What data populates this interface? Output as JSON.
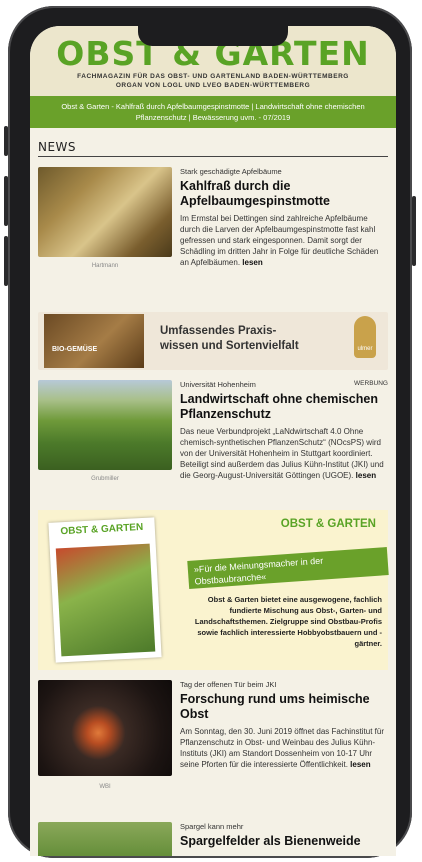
{
  "masthead": {
    "logo": "OBST & GARTEN",
    "tagline_1": "FACHMAGAZIN FÜR DAS OBST- UND GARTENLAND BADEN-WÜRTTEMBERG",
    "tagline_2": "ORGAN VON LOGL UND LVEO BADEN-WÜRTTEMBERG"
  },
  "topic_banner": "Obst & Garten - Kahlfraß durch Apfelbaumgespinstmotte | Landwirtschaft ohne chemischen Pflanzenschutz | Bewässerung uvm. - 07/2019",
  "news_heading": "NEWS",
  "articles": [
    {
      "kicker": "Stark geschädigte Apfelbäume",
      "headline": "Kahlfraß durch die Apfelbaumgespinstmotte",
      "body": "Im Ermstal bei Dettingen sind zahlreiche Apfelbäume durch die Larven der Apfelbaumgespinstmotte fast kahl gefressen und stark eingesponnen. Damit sorgt der Schädling im dritten Jahr in Folge für deutliche Schäden an Apfelbäumen.",
      "more": "lesen",
      "credit": "Hartmann"
    },
    {
      "kicker": "Universität Hohenheim",
      "label": "WERBUNG",
      "headline": "Landwirtschaft ohne chemischen Pflanzenschutz",
      "body": "Das neue Verbundprojekt „LaNdwirtschaft 4.0 Ohne chemisch-synthetischen PflanzenSchutz“ (NOcsPS) wird von der Universität Hohenheim in Stuttgart koordiniert. Beteiligt sind außerdem das Julius Kühn-Institut (JKI) und die Georg-August-Universität Göttingen (UGOE).",
      "more": "lesen",
      "credit": "Grubmiller"
    },
    {
      "kicker": "Tag der offenen Tür beim JKI",
      "headline": "Forschung rund ums heimische Obst",
      "body": "Am Sonntag, den 30. Juni 2019 öffnet das Fachinstitut für Pflanzenschutz in Obst- und Weinbau des Julius Kühn-Instituts (JKI) am Standort Dossenheim von 10-17 Uhr seine Pforten für die interessierte Öffentlichkeit.",
      "more": "lesen",
      "credit": "WBI"
    },
    {
      "kicker": "Spargel kann mehr",
      "headline": "Spargelfelder als Bienenweide"
    }
  ],
  "ad_banner": {
    "book_label": "BIO-GEMÜSE",
    "claim_1": "Umfassendes Praxis-",
    "claim_2": "wissen und Sortenvielfalt",
    "badge": "ulmer"
  },
  "promo": {
    "mag_title": "OBST & GARTEN",
    "title": "OBST & GARTEN",
    "band": "»Für die Meinungsmacher in der Obstbaubranche«",
    "body": "Obst & Garten bietet eine ausgewogene, fachlich fundierte Mischung aus Obst-, Garten- und Landschaftsthemen. Zielgruppe sind Obstbau-Profis sowie fachlich interessierte Hobbyobstbauern und -gärtner."
  }
}
